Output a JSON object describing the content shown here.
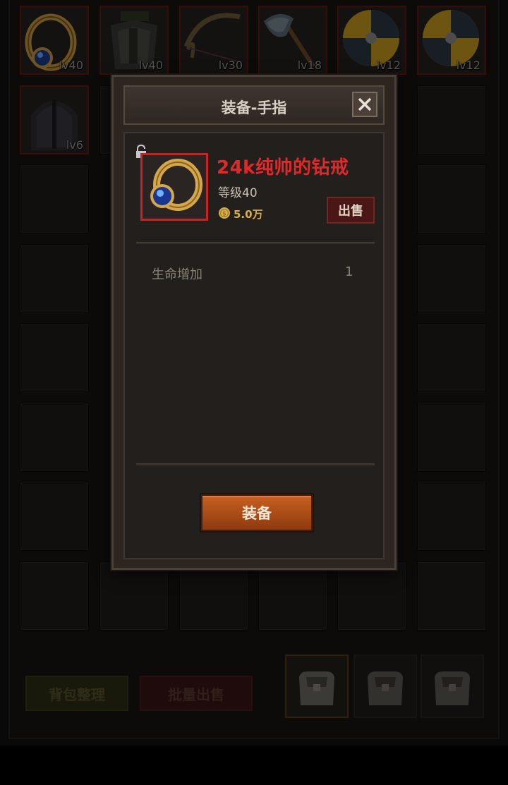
{
  "inventory": {
    "equipped_items": [
      {
        "icon": "ring-icon",
        "level": "lv40"
      },
      {
        "icon": "armor-icon",
        "level": "lv40"
      },
      {
        "icon": "bow-icon",
        "level": "lv30"
      },
      {
        "icon": "axe-icon",
        "level": "lv18"
      },
      {
        "icon": "shield-icon",
        "level": "lv12"
      },
      {
        "icon": "shield-icon",
        "level": "lv12"
      },
      {
        "icon": "helmet-icon",
        "level": "lv6"
      }
    ],
    "sort_label": "背包整理",
    "bulk_sell_label": "批量出售",
    "bag_tabs": [
      "bag-icon",
      "bag-icon",
      "bag-icon"
    ]
  },
  "dialog": {
    "title": "装备-手指",
    "item": {
      "icon": "ring-icon",
      "name": "24k纯帅的钻戒",
      "level_text": "等级40",
      "price": "5.0万",
      "sell_label": "出售"
    },
    "stats": [
      {
        "name": "生命增加",
        "value": "1"
      }
    ],
    "equip_label": "装备"
  },
  "colors": {
    "item_name": "#e02a2a",
    "equip_button": "#c86020",
    "coin": "#d8b050"
  }
}
